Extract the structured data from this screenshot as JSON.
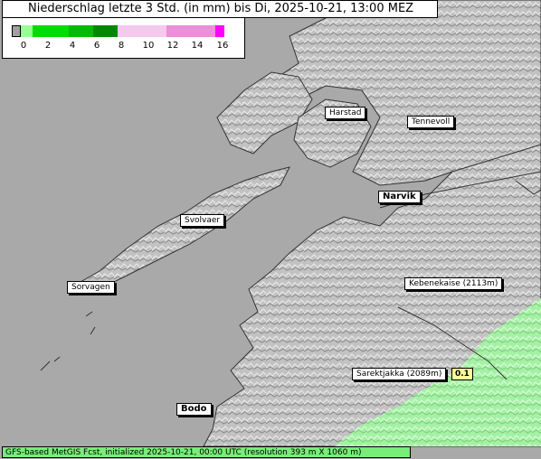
{
  "title": "Niederschlag letzte 3 Std. (in mm) bis Di, 2025-10-21, 13:00 MEZ",
  "legend": {
    "ticks": [
      "0",
      "2",
      "4",
      "6",
      "8",
      "10",
      "12",
      "14",
      "16"
    ],
    "colors": [
      "#a0a0a0",
      "#99ff99",
      "#00dd00",
      "#00bb00",
      "#008800",
      "#f5c8ee",
      "#efa8e3",
      "#e080d0",
      "#ff00ff"
    ]
  },
  "places": [
    {
      "name": "Harstad",
      "bold": false
    },
    {
      "name": "Tennevoll",
      "bold": false
    },
    {
      "name": "Narvik",
      "bold": true
    },
    {
      "name": "Svolvaer",
      "bold": false
    },
    {
      "name": "Sorvagen",
      "bold": false
    },
    {
      "name": "Kebenekaise (2113m)",
      "bold": false
    },
    {
      "name": "Sarektjakka (2089m)",
      "bold": false
    },
    {
      "name": "Bodo",
      "bold": true
    }
  ],
  "values": {
    "sarektjakka": "0.1"
  },
  "footer": "GFS-based MetGIS Fcst, initialized 2025-10-21, 00:00 UTC  (resolution 393 m X 1060 m)"
}
